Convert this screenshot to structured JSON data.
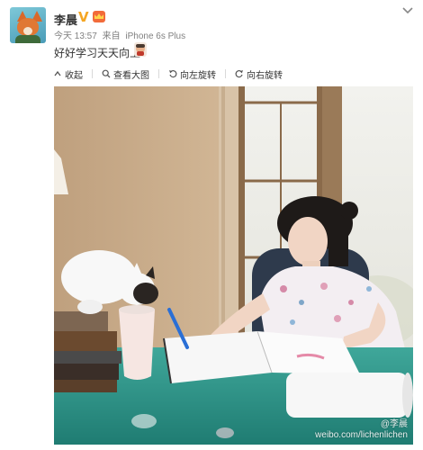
{
  "post": {
    "username": "李晨",
    "vip_badge": "V",
    "timestamp": "今天 13:57",
    "source_prefix": "来自",
    "source": "iPhone 6s Plus",
    "text": "好好学习天天向上"
  },
  "toolbar": {
    "collapse_label": "收起",
    "view_large_label": "查看大图",
    "rotate_left_label": "向左旋转",
    "rotate_right_label": "向右旋转"
  },
  "photo": {
    "watermark_name": "@李晨",
    "watermark_url": "weibo.com/lichenlichen"
  },
  "icons": {
    "avatar": "avatar-fox",
    "verified": "v-badge-icon",
    "crown": "crown-badge-icon",
    "menu": "chevron-down-icon",
    "emoji": "emoji-icon",
    "collapse": "collapse-icon",
    "search": "search-icon",
    "rotate_left": "rotate-left-icon",
    "rotate_right": "rotate-right-icon"
  },
  "colors": {
    "vip": "#f5a623",
    "text": "#333333",
    "meta": "#808080"
  }
}
